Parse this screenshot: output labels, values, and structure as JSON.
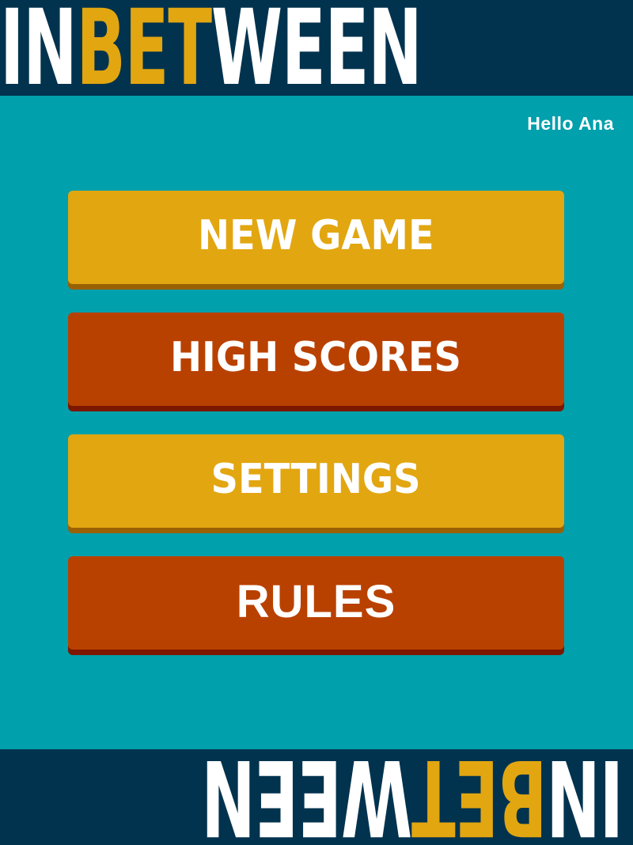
{
  "header": {
    "logo": [
      {
        "text": "IN",
        "accent": false
      },
      {
        "text": "BET",
        "accent": true
      },
      {
        "text": "WEEN",
        "accent": false
      }
    ]
  },
  "footer": {
    "logo": [
      {
        "text": "IN",
        "accent": false
      },
      {
        "text": "BET",
        "accent": true
      },
      {
        "text": "WEEN",
        "accent": false
      }
    ]
  },
  "greeting": "Hello Ana",
  "menu": {
    "new_game": "NEW GAME",
    "high_scores": "HIGH SCORES",
    "settings": "SETTINGS",
    "rules": "RULES"
  },
  "colors": {
    "background": "#00a0ac",
    "banner": "#02334e",
    "gold": "#e2a611",
    "rust": "#b94100",
    "text": "#ffffff"
  }
}
